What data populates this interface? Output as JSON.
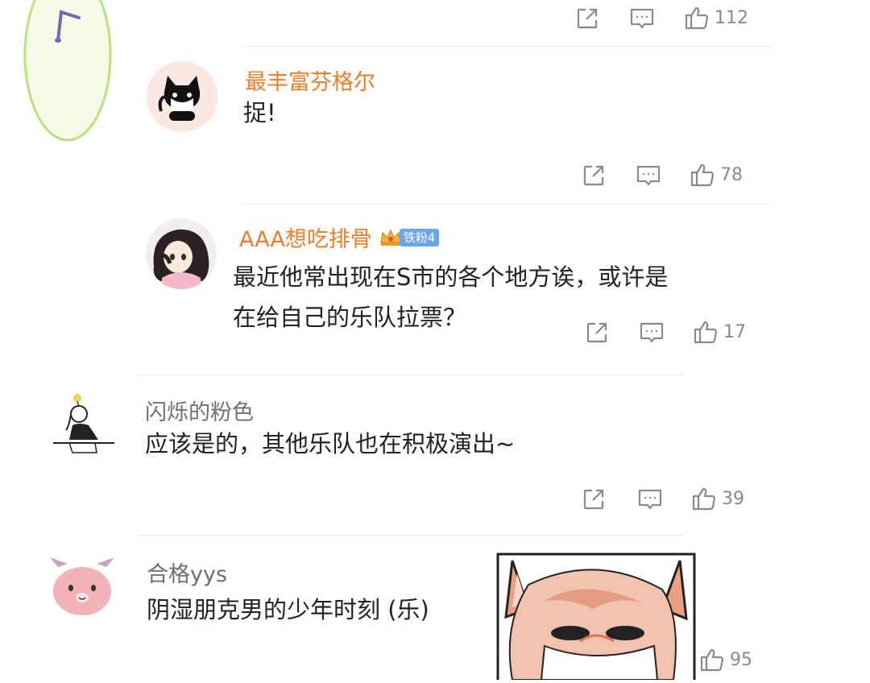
{
  "comments": [
    {
      "likes": "112"
    },
    {
      "user": "最丰富芬格尔",
      "text": [
        "捉!"
      ],
      "likes": "78",
      "avatar_icon": "black-cat-avatar"
    },
    {
      "user": "AAA想吃排骨",
      "badge": "铁粉4",
      "text": [
        "最近他常出现在S市的各个地方诶，或许是",
        "在给自己的乐队拉票？"
      ],
      "likes": "17",
      "avatar_icon": "anime-girl-avatar"
    },
    {
      "user": "闪烁的粉色",
      "text": [
        "应该是的，其他乐队也在积极演出~"
      ],
      "likes": "39",
      "avatar_icon": "girl-reading-avatar"
    },
    {
      "user": "合格yys",
      "text": [
        "阴湿朋克男的少年时刻 (乐)"
      ],
      "likes": "95",
      "avatar_icon": "pink-bunny-avatar"
    }
  ],
  "icons": {
    "share": "share-icon",
    "reply": "comment-icon",
    "like": "thumbs-up-icon",
    "floating": "music-note-icon",
    "sticker": "fox-sticker"
  },
  "colors": {
    "username_vip": "#f07c2a",
    "username_normal": "#707070",
    "badge": "#6aa6ef",
    "count": "#8a8a8a"
  }
}
